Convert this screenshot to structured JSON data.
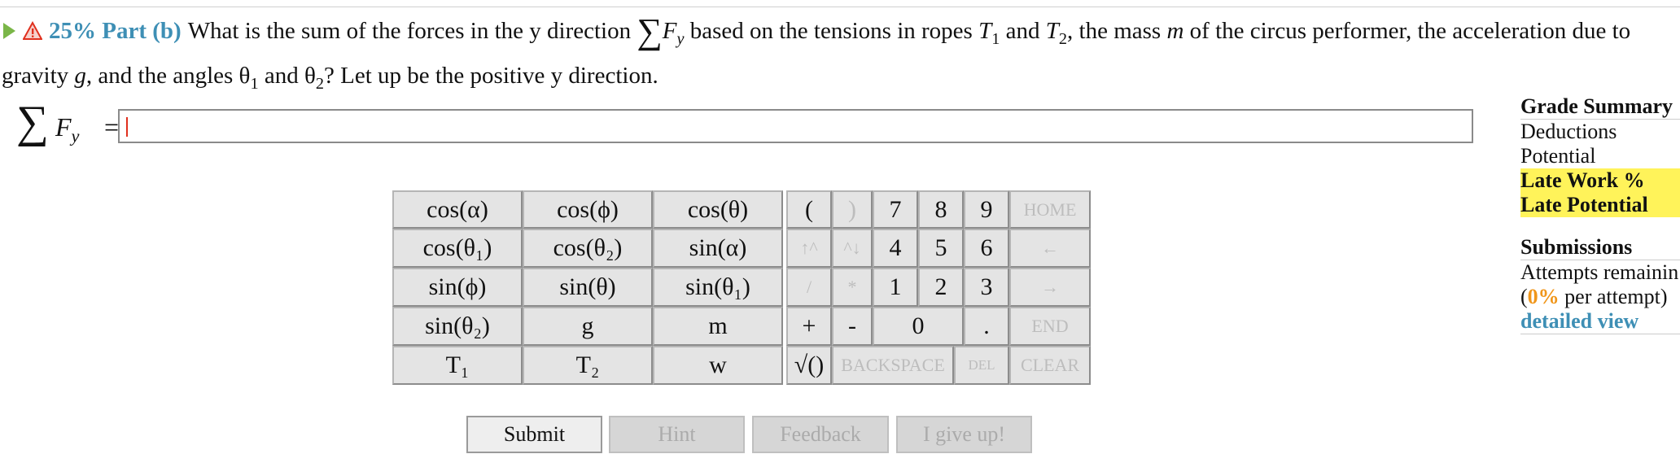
{
  "question": {
    "part_label": "25% Part (b)",
    "text_1": "What is the sum of the forces in the y direction",
    "sigma": "∑",
    "F": "F",
    "y_sub": "y",
    "text_2": "based on the tensions in ropes",
    "T": "T",
    "sub1": "1",
    "and": "and",
    "sub2": "2",
    "text_3": ", the mass",
    "m": "m",
    "text_4": "of the circus performer, the acceleration due to gravity",
    "g": "g",
    "text_5": ", and the angles θ",
    "text_6": "and θ",
    "text_7": "? Let up be the positive y direction."
  },
  "formula": {
    "sigma": "∑",
    "label": "F",
    "sub": "y",
    "equals": "="
  },
  "keypad": {
    "vars": [
      [
        "cos(α)",
        "cos(ϕ)",
        "cos(θ)"
      ],
      [
        "cos(θ₁)",
        "cos(θ₂)",
        "sin(α)"
      ],
      [
        "sin(ϕ)",
        "sin(θ)",
        "sin(θ₁)"
      ],
      [
        "sin(θ₂)",
        "g",
        "m"
      ],
      [
        "T₁",
        "T₂",
        "w"
      ]
    ],
    "ops": {
      "open_paren": "(",
      "close_paren": ")",
      "up_caret": "↑^",
      "down_caret": "^↓",
      "divide": "/",
      "multiply": "*",
      "plus": "+",
      "minus": "-",
      "sqrt": "√()",
      "backspace": "BACKSPACE",
      "del": "DEL",
      "clear": "CLEAR",
      "home": "HOME",
      "left": "←",
      "right": "→",
      "end": "END",
      "dot": "."
    },
    "digits": [
      "7",
      "8",
      "9",
      "4",
      "5",
      "6",
      "1",
      "2",
      "3",
      "0"
    ]
  },
  "buttons": {
    "submit": "Submit",
    "hint": "Hint",
    "feedback": "Feedback",
    "give_up": "I give up!"
  },
  "grade_summary": {
    "title": "Grade Summary",
    "deductions": "Deductions",
    "potential": "Potential",
    "late_work": "Late Work %",
    "late_potential": "Late Potential",
    "submissions_title": "Submissions",
    "attempts": "Attempts remainin",
    "per_attempt_open": "(",
    "per_attempt_pct": "0%",
    "per_attempt_rest": " per attempt)",
    "detailed_view": "detailed view"
  },
  "colors": {
    "accent": "#3e8fb5",
    "play_icon": "#7ab648",
    "warning": "#e0301e",
    "highlight": "#fff35a",
    "percent": "#f0961a"
  }
}
